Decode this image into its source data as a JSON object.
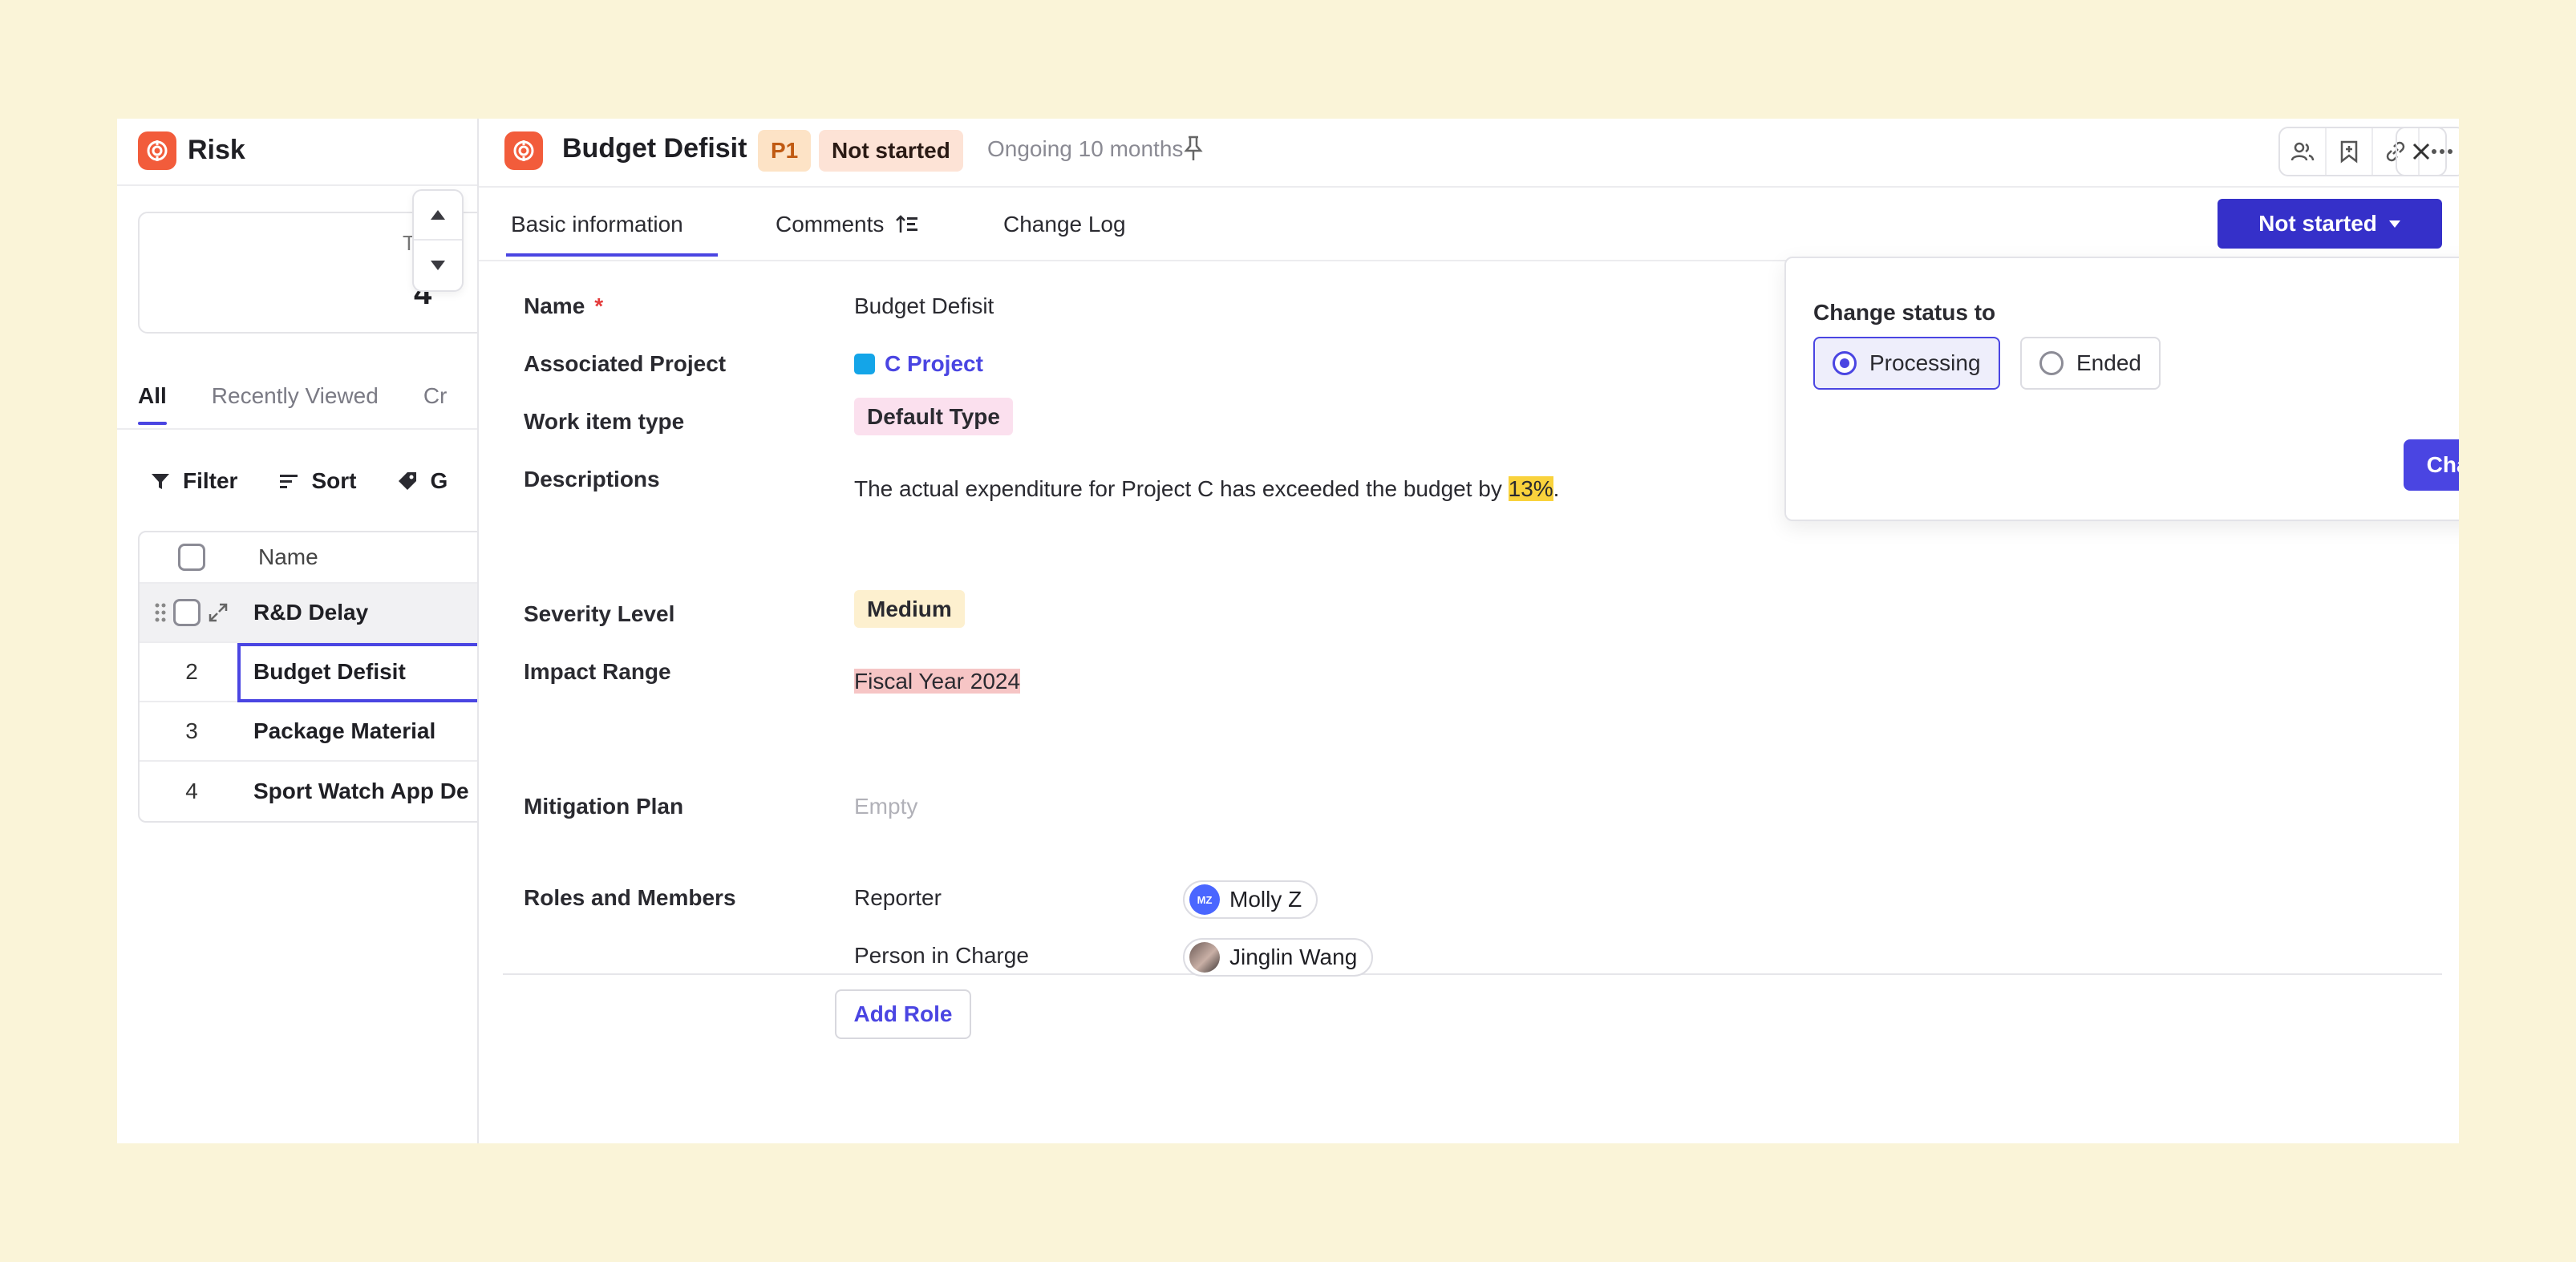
{
  "left_panel": {
    "app_title": "Risk",
    "stat": {
      "label": "T",
      "value": "4"
    },
    "view_tabs": [
      "All",
      "Recently Viewed",
      "Cr"
    ],
    "toolbar": {
      "filter": "Filter",
      "sort": "Sort",
      "group": "G"
    },
    "table": {
      "header_name": "Name",
      "rows": [
        {
          "num": "",
          "name": "R&D Delay"
        },
        {
          "num": "2",
          "name": "Budget Defisit"
        },
        {
          "num": "3",
          "name": "Package Material"
        },
        {
          "num": "4",
          "name": "Sport Watch App De"
        }
      ]
    }
  },
  "header": {
    "title": "Budget Defisit",
    "priority": "P1",
    "status": "Not started",
    "ongoing": "Ongoing 10 months"
  },
  "detail_tabs": {
    "basic": "Basic information",
    "comments": "Comments",
    "changelog": "Change Log"
  },
  "status_button": {
    "label": "Not started"
  },
  "fields": {
    "name": {
      "label": "Name",
      "required": "*",
      "value": "Budget Defisit"
    },
    "project": {
      "label": "Associated Project",
      "value": "C Project"
    },
    "work_item_type": {
      "label": "Work item type",
      "value": "Default Type"
    },
    "descriptions": {
      "label": "Descriptions",
      "text_before": "The actual expenditure for Project C has exceeded the budget by ",
      "highlight": "13%",
      "text_after": "."
    },
    "severity": {
      "label": "Severity Level",
      "value": "Medium"
    },
    "impact": {
      "label": "Impact Range",
      "value": "Fiscal Year 2024"
    },
    "mitigation": {
      "label": "Mitigation Plan",
      "value": "Empty"
    }
  },
  "roles": {
    "label": "Roles and Members",
    "items": [
      {
        "role": "Reporter",
        "member": "Molly Z",
        "initials": "MZ"
      },
      {
        "role": "Person in Charge",
        "member": "Jinglin Wang",
        "initials": ""
      }
    ],
    "add_label": "Add Role"
  },
  "popover": {
    "title": "Change status to",
    "options": [
      "Processing",
      "Ended"
    ],
    "selected": "Processing",
    "button": "Change"
  },
  "colors": {
    "accent": "#4a45e2",
    "status_button": "#3530c9",
    "brand_logo": "#f25c3b",
    "background": "#faf4d8"
  },
  "icons": [
    "risk-logo-icon",
    "pin-icon",
    "members-icon",
    "bookmark-icon",
    "link-icon",
    "more-icon",
    "close-icon",
    "filter-icon",
    "sort-icon",
    "tag-icon",
    "drag-handle-icon",
    "expand-icon",
    "caret-down-icon",
    "sort-order-icon",
    "chevron-up-icon",
    "chevron-down-icon"
  ]
}
